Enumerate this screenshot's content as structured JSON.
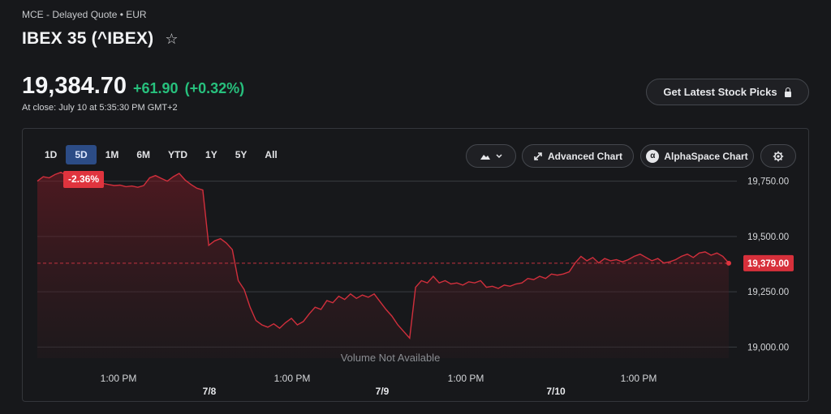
{
  "header": {
    "subtitle": "MCE - Delayed Quote • EUR",
    "title": "IBEX 35 (^IBEX)"
  },
  "quote": {
    "price": "19,384.70",
    "change": "+61.90",
    "change_pct": "(+0.32%)",
    "close_time": "At close: July 10 at 5:35:30 PM GMT+2",
    "up_color": "#27c07d"
  },
  "picks_button": {
    "label": "Get Latest Stock Picks"
  },
  "chart_toolbar": {
    "ranges": [
      "1D",
      "5D",
      "1M",
      "6M",
      "YTD",
      "1Y",
      "5Y",
      "All"
    ],
    "active_range": "5D",
    "range_change": "-2.36%",
    "advanced_label": "Advanced Chart",
    "alpha_label": "AlphaSpace Chart"
  },
  "chart_data": {
    "type": "area",
    "x_tick_labels": [
      "1:00 PM",
      "1:00 PM",
      "1:00 PM",
      "1:00 PM"
    ],
    "day_labels": [
      "7/8",
      "7/9",
      "7/10"
    ],
    "y_ticks": [
      19000,
      19250,
      19500,
      19750
    ],
    "y_tick_labels": [
      "19,000.00",
      "19,250.00",
      "19,500.00",
      "19,750.00"
    ],
    "ylim": [
      18950,
      19840
    ],
    "previous_close": 19379.0,
    "previous_close_label": "19,379.00",
    "volume_note": "Volume Not Available",
    "line_color": "#d12f3c",
    "series": [
      {
        "values": [
          19750,
          19770,
          19765,
          19780,
          19790,
          19775,
          19785,
          19770,
          19760,
          19755,
          19745,
          19740,
          19735,
          19730,
          19732,
          19725,
          19728,
          19722,
          19730,
          19765,
          19775,
          19762,
          19750,
          19770,
          19785,
          19755,
          19735,
          19718,
          19710,
          19460,
          19480,
          19490,
          19470,
          19440,
          19300,
          19260,
          19180,
          19120,
          19100,
          19090,
          19105,
          19085,
          19110,
          19130,
          19100,
          19115,
          19150,
          19180,
          19170,
          19210,
          19200,
          19230,
          19215,
          19240,
          19220,
          19235,
          19225,
          19240,
          19205,
          19170,
          19140,
          19100,
          19070,
          19040,
          19270,
          19300,
          19290,
          19320,
          19290,
          19300,
          19285,
          19290,
          19280,
          19295,
          19290,
          19300,
          19270,
          19275,
          19265,
          19280,
          19275,
          19285,
          19290,
          19310,
          19305,
          19320,
          19310,
          19330,
          19325,
          19330,
          19340,
          19380,
          19410,
          19390,
          19405,
          19380,
          19400,
          19390,
          19395,
          19385,
          19395,
          19410,
          19420,
          19405,
          19390,
          19400,
          19380,
          19385,
          19395,
          19410,
          19420,
          19405,
          19425,
          19430,
          19415,
          19425,
          19410,
          19380
        ]
      }
    ]
  }
}
